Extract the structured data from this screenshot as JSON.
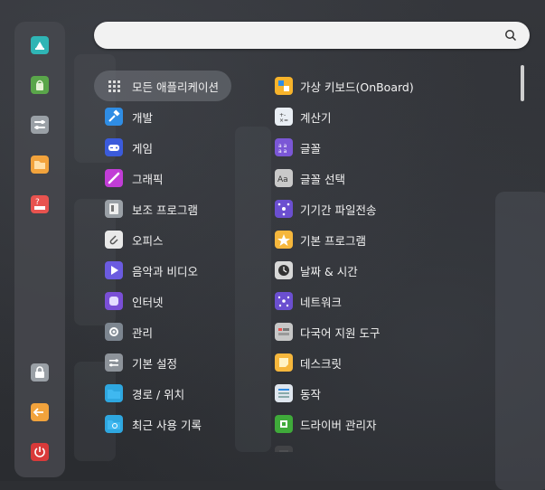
{
  "search": {
    "value": "",
    "placeholder": ""
  },
  "dock": [
    {
      "name": "deepin-store-icon",
      "color": "#2fb5b5"
    },
    {
      "name": "app-store-icon",
      "color": "#5aa64a"
    },
    {
      "name": "control-center-icon",
      "color": "#9aa0a6"
    },
    {
      "name": "file-manager-icon",
      "color": "#f2a33c"
    },
    {
      "name": "manual-icon",
      "color": "#e8534f"
    }
  ],
  "dock_bottom": [
    {
      "name": "lock-icon",
      "color": "#9aa0a6"
    },
    {
      "name": "logout-icon",
      "color": "#f2a33c"
    },
    {
      "name": "power-icon",
      "color": "#d93a3a"
    }
  ],
  "categories": [
    {
      "label": "모든 애플리케이션",
      "icon": "grid-icon",
      "color": "transparent",
      "active": true
    },
    {
      "label": "개발",
      "icon": "hammer-icon",
      "color": "#2f8de4"
    },
    {
      "label": "게임",
      "icon": "gamepad-icon",
      "color": "#3b5bdb"
    },
    {
      "label": "그래픽",
      "icon": "brush-icon",
      "color": "#c13dd6"
    },
    {
      "label": "보조 프로그램",
      "icon": "accessory-icon",
      "color": "#9aa0a6"
    },
    {
      "label": "오피스",
      "icon": "paperclip-icon",
      "color": "#e9e9e9"
    },
    {
      "label": "음악과 비디오",
      "icon": "play-icon",
      "color": "#6b5be0"
    },
    {
      "label": "인터넷",
      "icon": "internet-icon",
      "color": "#7a4fd6"
    },
    {
      "label": "관리",
      "icon": "gear-icon",
      "color": "#7d8690"
    },
    {
      "label": "기본 설정",
      "icon": "settings-icon",
      "color": "#8d939a"
    },
    {
      "label": "경로 / 위치",
      "icon": "folder-icon",
      "color": "#2ea7e0"
    },
    {
      "label": "최근 사용 기록",
      "icon": "recent-folder-icon",
      "color": "#2ea7e0"
    }
  ],
  "apps": [
    {
      "label": "가상 키보드(OnBoard)",
      "icon": "onboard-icon",
      "color": "#f7b32b"
    },
    {
      "label": "계산기",
      "icon": "calculator-icon",
      "color": "#e9eef4"
    },
    {
      "label": "글꼴",
      "icon": "fonts-icon",
      "color": "#7b57d6"
    },
    {
      "label": "글꼴 선택",
      "icon": "font-select-icon",
      "color": "#c9c9c9"
    },
    {
      "label": "기기간 파일전송",
      "icon": "transfer-icon",
      "color": "#6b4fd0"
    },
    {
      "label": "기본 프로그램",
      "icon": "star-icon",
      "color": "#f6b73c"
    },
    {
      "label": "날짜 & 시간",
      "icon": "clock-icon",
      "color": "#d8d8d8"
    },
    {
      "label": "네트워크",
      "icon": "network-icon",
      "color": "#6b4fd0"
    },
    {
      "label": "다국어 지원 도구",
      "icon": "language-icon",
      "color": "#c7c7c7"
    },
    {
      "label": "데스크릿",
      "icon": "note-icon",
      "color": "#f6b73c"
    },
    {
      "label": "동작",
      "icon": "action-icon",
      "color": "#dfe6ee"
    },
    {
      "label": "드라이버 관리자",
      "icon": "driver-icon",
      "color": "#3faa3a"
    },
    {
      "label": "",
      "icon": "next-icon",
      "color": "#666666",
      "faded": true
    }
  ]
}
